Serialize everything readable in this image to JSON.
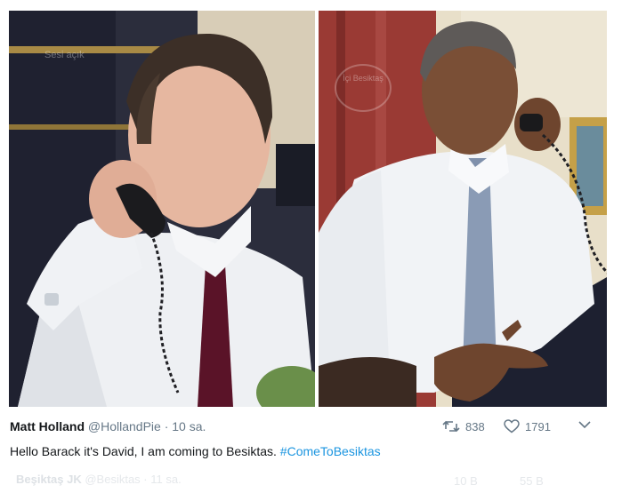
{
  "photos": {
    "left_alt": "",
    "right_alt": "",
    "watermarks": {
      "left_text": "Sesi açık",
      "right_stamp": "İçi Besiktaş"
    }
  },
  "tweet": {
    "author_name": "Matt Holland",
    "handle": "@HollandPie",
    "separator": "·",
    "time": "10 sa.",
    "text": "Hello Barack it's David, I am coming to Besiktas.",
    "hashtag": "#ComeToBesiktas",
    "retweets": "838",
    "likes": "1791",
    "icons": [
      "retweet-icon",
      "heart-icon",
      "chevron-down-icon"
    ]
  },
  "ghost_tweet": {
    "author_name": "Beşiktaş JK",
    "handle": "@Besiktas",
    "time": "11 sa.",
    "retweets": "10 B",
    "likes": "55 B"
  },
  "colors": {
    "text": "#14171a",
    "secondary": "#657786",
    "link": "#1b95e0"
  }
}
